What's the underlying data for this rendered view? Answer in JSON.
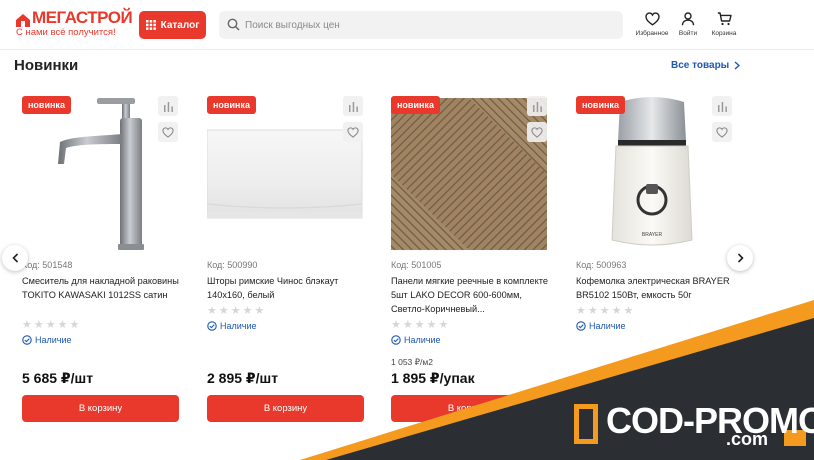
{
  "header": {
    "logo_text": "МЕГАСТРОЙ",
    "logo_tagline": "С нами всё получится!",
    "catalog_label": "Каталог",
    "search_placeholder": "Поиск выгодных цен",
    "favorites_label": "Избранное",
    "login_label": "Войти",
    "cart_label": "Корзина"
  },
  "section": {
    "title": "Новинки",
    "all_link": "Все товары"
  },
  "products": [
    {
      "badge": "новинка",
      "code": "Код: 501548",
      "name": "Смеситель для накладной раковины TOKITO KAWASAKI 1012SS сатин",
      "rating_stars": 0,
      "stock": "Наличие",
      "unit_price": "",
      "price": "5 685 ₽/шт",
      "button": "В корзину",
      "image": "faucet"
    },
    {
      "badge": "новинка",
      "code": "Код: 500990",
      "name": "Шторы римские Чинос блэкаут 140x160, белый",
      "rating_stars": 0,
      "stock": "Наличие",
      "unit_price": "",
      "price": "2 895 ₽/шт",
      "button": "В корзину",
      "image": "blind"
    },
    {
      "badge": "новинка",
      "code": "Код: 501005",
      "name": "Панели мягкие реечные в комплекте 5шт LAKO DECOR 600-600мм, Светло-Коричневый...",
      "rating_stars": 0,
      "stock": "Наличие",
      "unit_price": "1 053 ₽/м2",
      "price": "1 895 ₽/упак",
      "button": "В корзину",
      "image": "panel"
    },
    {
      "badge": "новинка",
      "code": "Код: 500963",
      "name": "Кофемолка электрическая BRAYER BR5102 150Вт, емкость 50г",
      "rating_stars": 0,
      "stock": "Наличие",
      "unit_price": "",
      "price": "",
      "button": "",
      "image": "grinder"
    }
  ],
  "grinder_brand": "BRAYER",
  "watermark": {
    "main": "COD-PROMO",
    "sub": ".com"
  },
  "colors": {
    "accent": "#e8392c",
    "link": "#1c57b4",
    "promo_dark": "#2b2f33",
    "promo_orange": "#f39a1f"
  }
}
